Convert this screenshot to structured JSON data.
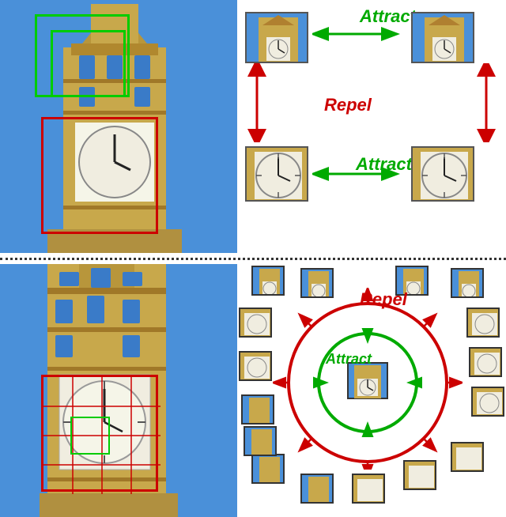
{
  "top": {
    "attract_label": "Attract",
    "repel_label": "Repel",
    "attract_label2": "Attract"
  },
  "bottom": {
    "repel_label": "Repel",
    "attract_label": "Attract"
  },
  "colors": {
    "green": "#00aa00",
    "red": "#cc0000",
    "sky": "#5ba8e8"
  }
}
